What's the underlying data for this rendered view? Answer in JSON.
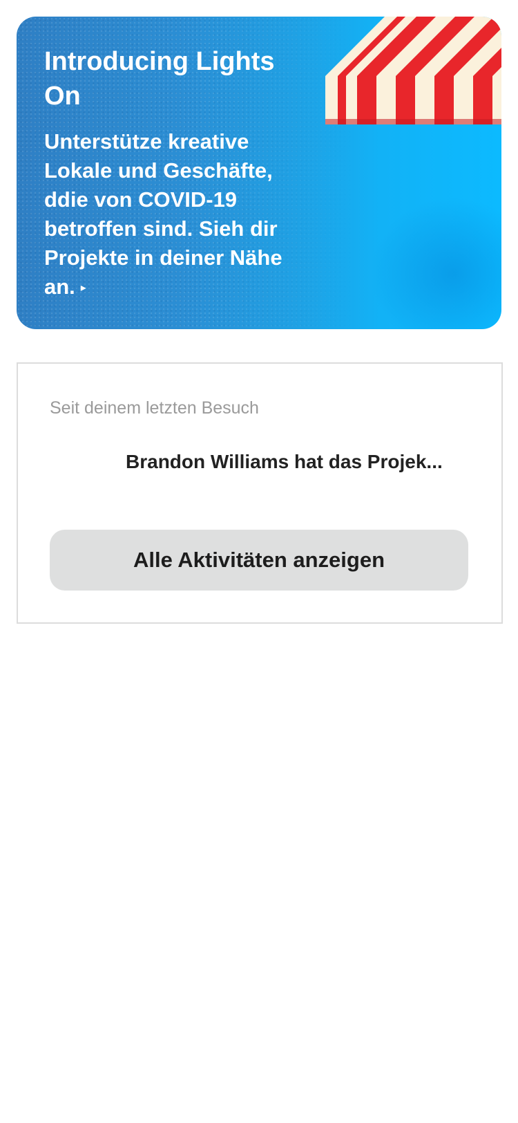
{
  "promo": {
    "title": "Introducing Lights On",
    "body": "Unterstütze kreative Lokale und Geschäfte, ddie von COVID-19 betroffen sind. Sieh dir Projekte in deiner Nähe an.",
    "arrow_glyph": "▸",
    "colors": {
      "gradient_start": "#2f7fc4",
      "gradient_end": "#0cbaff",
      "awning_red": "#e8262b",
      "awning_cream": "#fbf1dc"
    }
  },
  "activity": {
    "section_label": "Seit deinem letzten Besuch",
    "items": [
      {
        "text": "Brandon Williams hat das Projek..."
      }
    ],
    "button_label": "Alle Aktivitäten anzeigen"
  }
}
